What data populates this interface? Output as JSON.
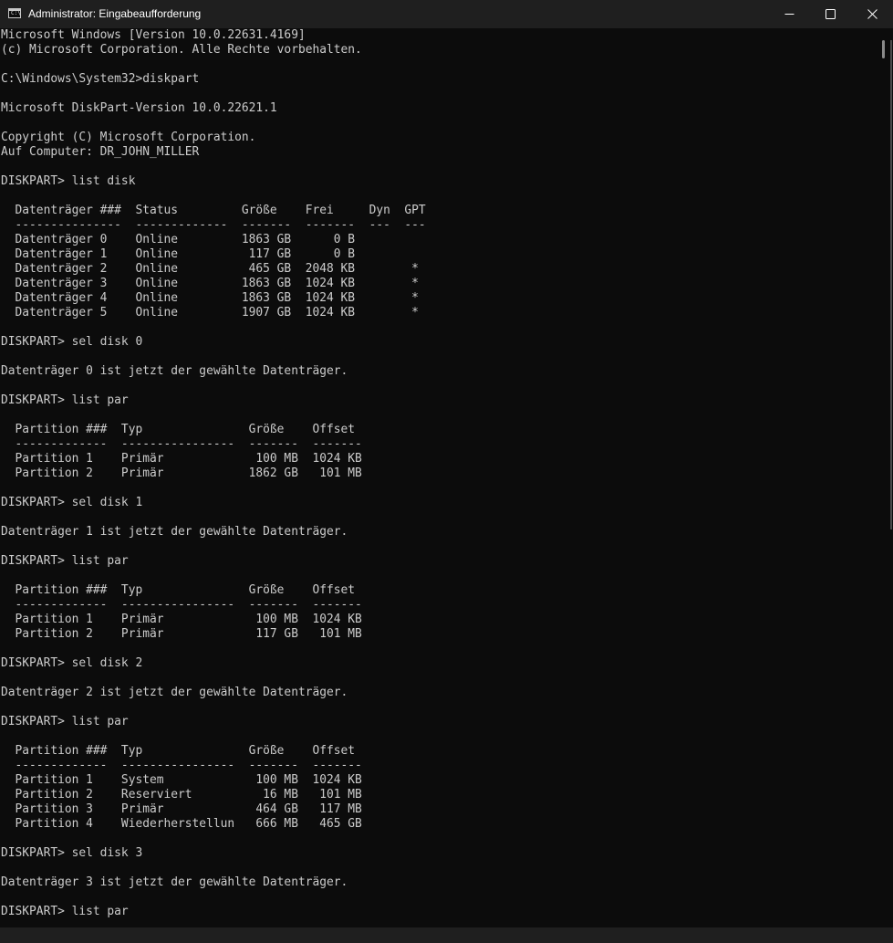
{
  "window": {
    "title": "Administrator: Eingabeaufforderung",
    "icon": "cmd-icon",
    "icon_glyph": "C:\\"
  },
  "controls": {
    "minimize_icon": "minimize-icon",
    "maximize_icon": "maximize-icon",
    "close_icon": "close-icon"
  },
  "console": {
    "lines": [
      "Microsoft Windows [Version 10.0.22631.4169]",
      "(c) Microsoft Corporation. Alle Rechte vorbehalten.",
      "",
      "C:\\Windows\\System32>diskpart",
      "",
      "Microsoft DiskPart-Version 10.0.22621.1",
      "",
      "Copyright (C) Microsoft Corporation.",
      "Auf Computer: DR_JOHN_MILLER",
      "",
      "DISKPART> list disk",
      "",
      "  Datenträger ###  Status         Größe    Frei     Dyn  GPT",
      "  ---------------  -------------  -------  -------  ---  ---",
      "  Datenträger 0    Online         1863 GB      0 B",
      "  Datenträger 1    Online          117 GB      0 B",
      "  Datenträger 2    Online          465 GB  2048 KB        *",
      "  Datenträger 3    Online         1863 GB  1024 KB        *",
      "  Datenträger 4    Online         1863 GB  1024 KB        *",
      "  Datenträger 5    Online         1907 GB  1024 KB        *",
      "",
      "DISKPART> sel disk 0",
      "",
      "Datenträger 0 ist jetzt der gewählte Datenträger.",
      "",
      "DISKPART> list par",
      "",
      "  Partition ###  Typ               Größe    Offset",
      "  -------------  ----------------  -------  -------",
      "  Partition 1    Primär             100 MB  1024 KB",
      "  Partition 2    Primär            1862 GB   101 MB",
      "",
      "DISKPART> sel disk 1",
      "",
      "Datenträger 1 ist jetzt der gewählte Datenträger.",
      "",
      "DISKPART> list par",
      "",
      "  Partition ###  Typ               Größe    Offset",
      "  -------------  ----------------  -------  -------",
      "  Partition 1    Primär             100 MB  1024 KB",
      "  Partition 2    Primär             117 GB   101 MB",
      "",
      "DISKPART> sel disk 2",
      "",
      "Datenträger 2 ist jetzt der gewählte Datenträger.",
      "",
      "DISKPART> list par",
      "",
      "  Partition ###  Typ               Größe    Offset",
      "  -------------  ----------------  -------  -------",
      "  Partition 1    System             100 MB  1024 KB",
      "  Partition 2    Reserviert          16 MB   101 MB",
      "  Partition 3    Primär             464 GB   117 MB",
      "  Partition 4    Wiederherstellun   666 MB   465 GB",
      "",
      "DISKPART> sel disk 3",
      "",
      "Datenträger 3 ist jetzt der gewählte Datenträger.",
      "",
      "DISKPART> list par"
    ]
  },
  "colors": {
    "console_bg": "#0c0c0c",
    "console_text": "#cccccc",
    "titlebar_bg": "#1f1f1f"
  }
}
